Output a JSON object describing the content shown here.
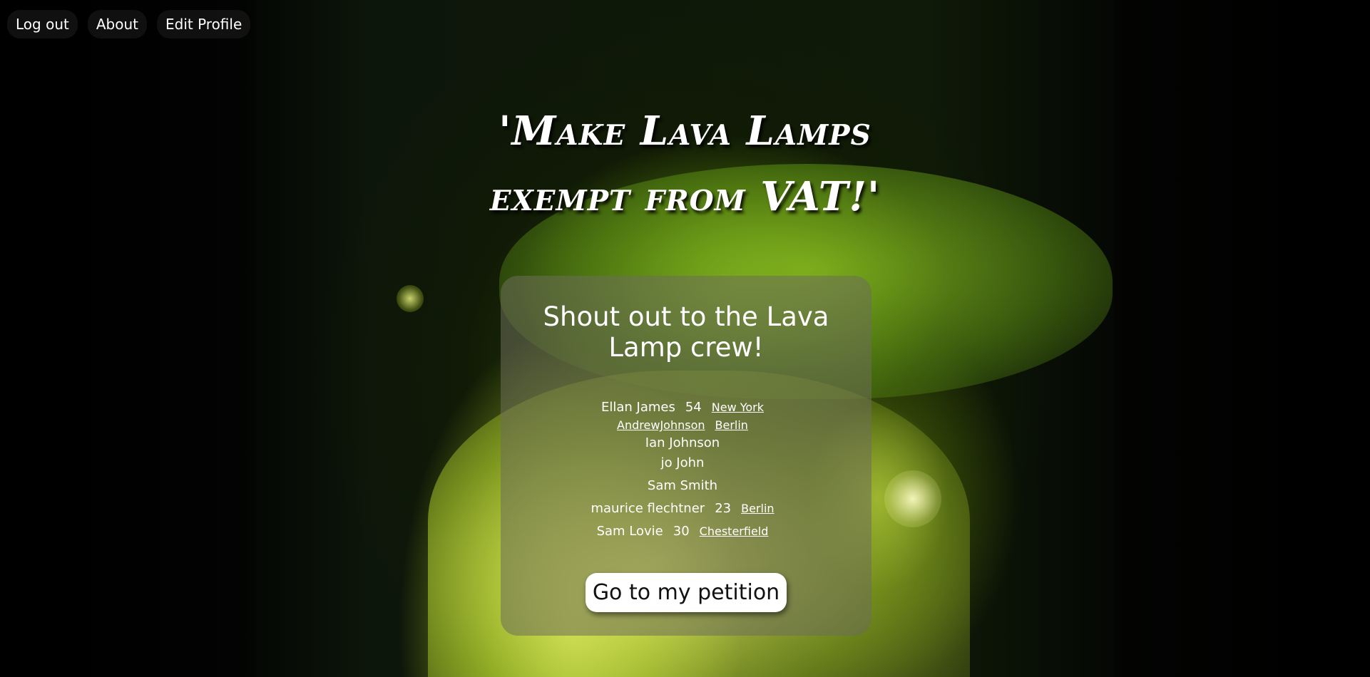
{
  "nav": {
    "logout_label": "Log out",
    "about_label": "About",
    "edit_profile_label": "Edit Profile"
  },
  "headline": {
    "line1": "'Make Lava Lamps",
    "line2": "exempt from VAT!'"
  },
  "card": {
    "title": "Shout out to the Lava Lamp crew!",
    "signers": [
      {
        "name": "Ellan James",
        "age": "54",
        "city": "New York"
      },
      {
        "name": "AndrewJohnson",
        "age": "",
        "city": "Berlin"
      },
      {
        "name": "Ian Johnson",
        "age": "",
        "city": ""
      },
      {
        "name": "jo John",
        "age": "",
        "city": ""
      },
      {
        "name": "Sam Smith",
        "age": "",
        "city": ""
      },
      {
        "name": "maurice flechtner",
        "age": "23",
        "city": "Berlin"
      },
      {
        "name": "Sam Lovie",
        "age": "30",
        "city": "Chesterfield"
      }
    ],
    "cta_label": "Go to my petition"
  },
  "colors": {
    "background": "#010101",
    "lava_green": "#8fb81e",
    "card_bg": "rgba(110,110,90,0.55)",
    "button_bg": "#ffffff"
  }
}
